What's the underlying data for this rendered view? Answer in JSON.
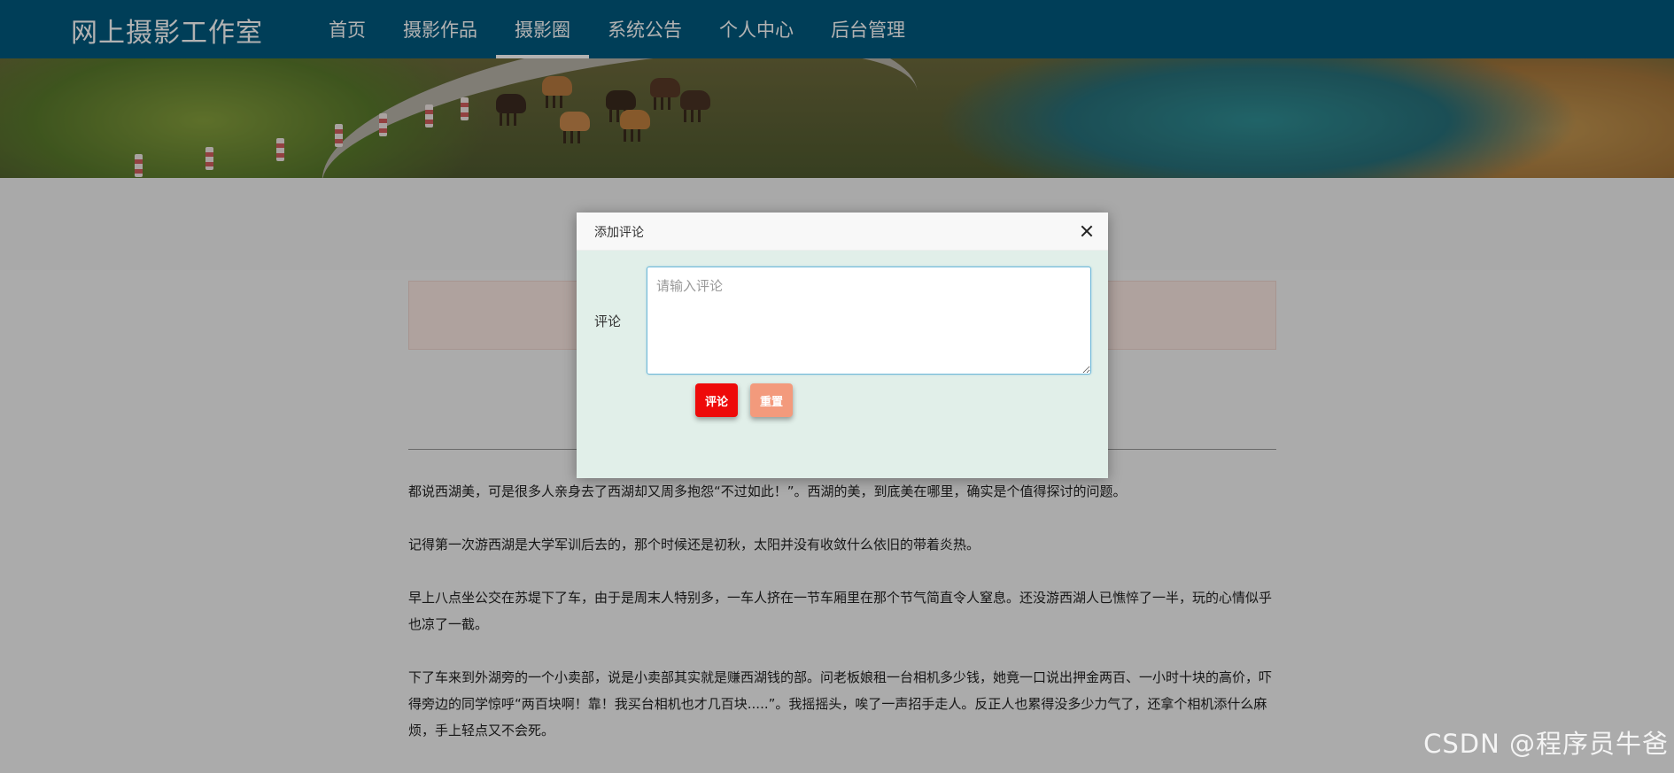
{
  "header": {
    "brand": "网上摄影工作室",
    "nav": [
      {
        "label": "首页"
      },
      {
        "label": "摄影作品"
      },
      {
        "label": "摄影圈",
        "active": true
      },
      {
        "label": "系统公告"
      },
      {
        "label": "个人中心"
      },
      {
        "label": "后台管理"
      }
    ]
  },
  "article": {
    "paragraphs": [
      "都说西湖美，可是很多人亲身去了西湖却又周多抱怨“不过如此！”。西湖的美，到底美在哪里，确实是个值得探讨的问题。",
      "记得第一次游西湖是大学军训后去的，那个时候还是初秋，太阳并没有收敛什么依旧的带着炎热。",
      "早上八点坐公交在苏堤下了车，由于是周末人特别多，一车人挤在一节车厢里在那个节气简直令人窒息。还没游西湖人已憔悴了一半，玩的心情似乎也凉了一截。",
      "下了车来到外湖旁的一个小卖部，说是小卖部其实就是赚西湖钱的部。问老板娘租一台相机多少钱，她竟一口说出押金两百、一小时十块的高价，吓得旁边的同学惊呼“两百块啊！靠！我买台相机也才几百块.....”。我摇摇头，唉了一声招手走人。反正人也累得没多少力气了，还拿个相机添什么麻烦，手上轻点又不会死。"
    ]
  },
  "dialog": {
    "title": "添加评论",
    "field_label": "评论",
    "input_placeholder": "请输入评论",
    "input_value": "",
    "submit_label": "评论",
    "reset_label": "重置"
  },
  "colors": {
    "nav_bg": "#005a7f",
    "dialog_body_bg": "#e1efe9",
    "submit_btn": "#ee0a0a",
    "reset_btn": "#f39a7c"
  },
  "watermark": "CSDN @程序员牛爸"
}
